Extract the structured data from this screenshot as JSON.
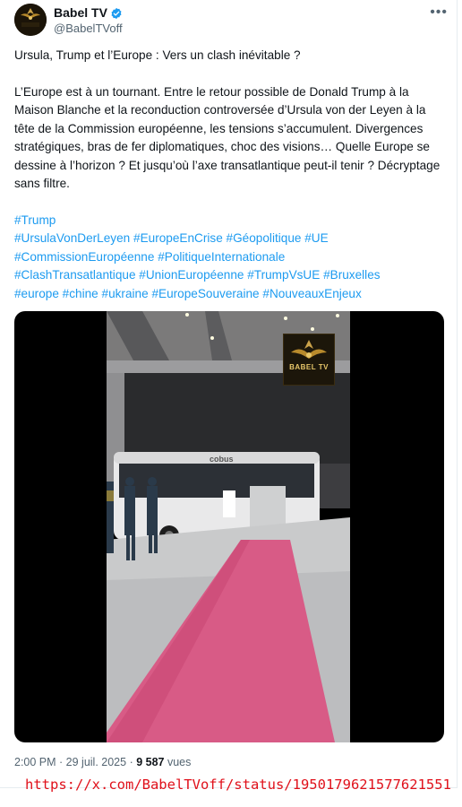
{
  "author": {
    "display_name": "Babel TV",
    "handle": "@BabelTVoff",
    "avatar_text": "BABEL TV"
  },
  "post": {
    "title": "Ursula, Trump et l’Europe : Vers un clash inévitable ?",
    "body": "L’Europe est à un tournant. Entre le retour possible de Donald Trump à la Maison Blanche et la reconduction controversée d’Ursula von der Leyen à la tête de la Commission européenne, les tensions s’accumulent. Divergences stratégiques, bras de fer diplomatiques, choc des visions… Quelle Europe se dessine à l’horizon ? Et jusqu’où l’axe transatlantique peut-il tenir ? Décryptage sans filtre.",
    "hashtag_lines": [
      [
        "#Trump"
      ],
      [
        "#UrsulaVonDerLeyen",
        "#EuropeEnCrise",
        "#Géopolitique",
        "#UE"
      ],
      [
        "#CommissionEuropéenne",
        "#PolitiqueInternationale"
      ],
      [
        "#ClashTransatlantique",
        "#UnionEuropéenne",
        "#TrumpVsUE",
        "#Bruxelles"
      ],
      [
        "#europe",
        "#chine",
        "#ukraine",
        "#EuropeSouveraine",
        "#NouveauxEnjeux"
      ]
    ]
  },
  "media": {
    "watermark_text": "BABEL TV",
    "bus_label": "cobus"
  },
  "meta": {
    "time": "2:00 PM",
    "separator": " · ",
    "date": "29 juil. 2025",
    "views_count": "9 587",
    "views_label": " vues"
  },
  "source_url": "https://x.com/BabelTVoff/status/1950179621577621551",
  "colors": {
    "link": "#1d9bf0",
    "secondary_text": "#536471",
    "url_note": "#e0101a",
    "carpet": "#d85b86"
  },
  "icons": {
    "verified": "verified-badge-icon",
    "more": "more-options-icon"
  }
}
